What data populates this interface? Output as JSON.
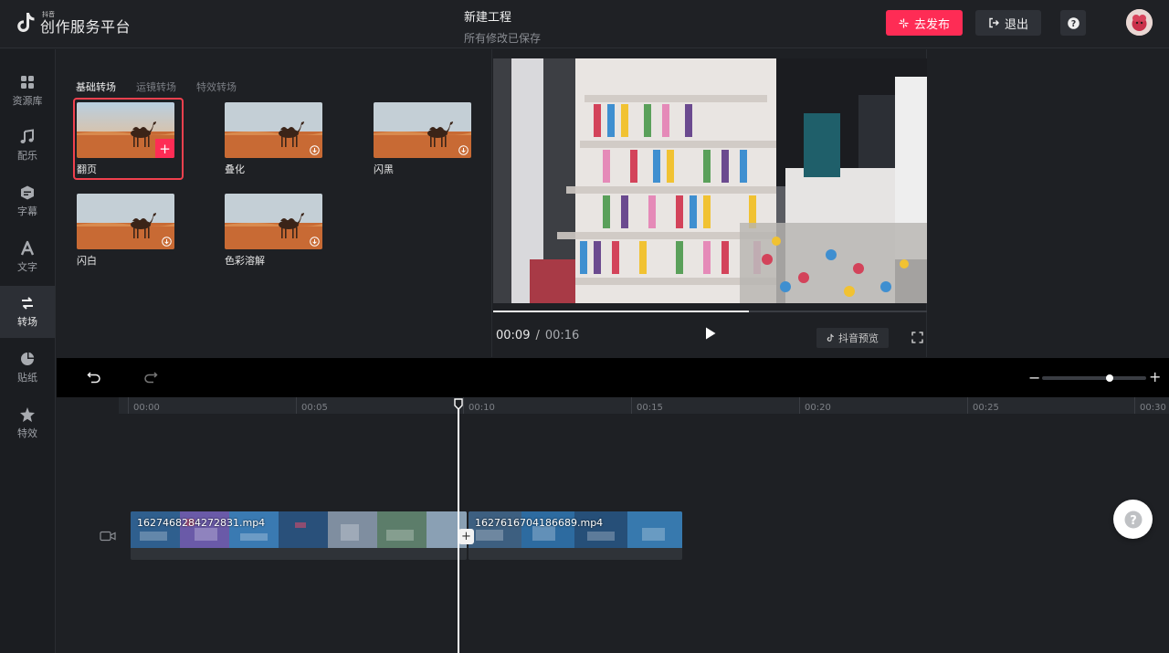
{
  "header": {
    "logo_small": "抖音",
    "logo_title": "创作服务平台",
    "project_title": "新建工程",
    "project_status": "所有修改已保存",
    "publish_label": "去发布",
    "exit_label": "退出"
  },
  "nav": {
    "items": [
      {
        "label": "资源库",
        "icon": "grid-icon"
      },
      {
        "label": "配乐",
        "icon": "music-note-icon"
      },
      {
        "label": "字幕",
        "icon": "subtitle-icon"
      },
      {
        "label": "文字",
        "icon": "text-icon"
      },
      {
        "label": "转场",
        "icon": "transition-icon"
      },
      {
        "label": "贴纸",
        "icon": "sticker-icon"
      },
      {
        "label": "特效",
        "icon": "effects-icon"
      }
    ],
    "active_index": 4
  },
  "panel": {
    "tabs": [
      {
        "label": "基础转场",
        "active": true
      },
      {
        "label": "运镜转场",
        "active": false
      },
      {
        "label": "特效转场",
        "active": false
      }
    ],
    "transitions": [
      {
        "label": "翻页",
        "selected": true
      },
      {
        "label": "叠化",
        "selected": false
      },
      {
        "label": "闪黑",
        "selected": false
      },
      {
        "label": "闪白",
        "selected": false
      },
      {
        "label": "色彩溶解",
        "selected": false
      }
    ]
  },
  "preview": {
    "current_time": "00:09",
    "separator": "/",
    "total_time": "00:16",
    "progress": 0.59,
    "douyin_preview_label": "抖音预览"
  },
  "timeline": {
    "ticks": [
      "00:00",
      "00:05",
      "00:10",
      "00:15",
      "00:20",
      "00:25",
      "00:30"
    ],
    "clips": [
      {
        "name": "1627468284272831.mp4"
      },
      {
        "name": "1627616704186689.mp4"
      }
    ],
    "playhead_time": "00:09",
    "zoom_level": 0.65
  },
  "colors": {
    "accent": "#fe2c55",
    "background": "#1e2024",
    "selected_outline": "#f0404e"
  }
}
